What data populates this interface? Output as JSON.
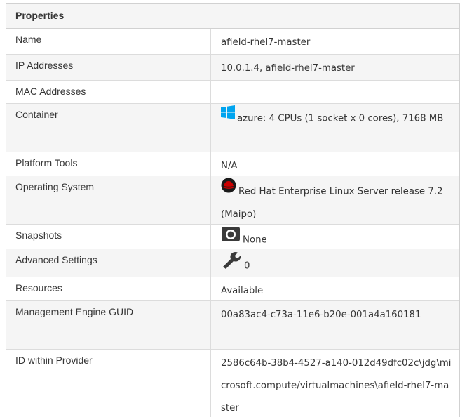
{
  "panel": {
    "title": "Properties",
    "rows": [
      {
        "label": "Name",
        "value": "afield-rhel7-master"
      },
      {
        "label": "IP Addresses",
        "value": "10.0.1.4, afield-rhel7-master"
      },
      {
        "label": "MAC Addresses",
        "value": ""
      },
      {
        "label": "Container",
        "value": "azure: 4 CPUs (1 socket x 0 cores), 7168 MB",
        "icon": "windows-logo-icon"
      },
      {
        "label": "Platform Tools",
        "value": "N/A"
      },
      {
        "label": "Operating System",
        "value": "Red Hat Enterprise Linux Server release 7.2 (Maipo)",
        "icon": "redhat-logo-icon"
      },
      {
        "label": "Snapshots",
        "value": "None",
        "icon": "camera-icon"
      },
      {
        "label": "Advanced Settings",
        "value": "0",
        "icon": "wrench-icon"
      },
      {
        "label": "Resources",
        "value": "Available"
      },
      {
        "label": "Management Engine GUID",
        "value": "00a83ac4-c73a-11e6-b20e-001a4a160181"
      },
      {
        "label": "ID within Provider",
        "value": "2586c64b-38b4-4527-a140-012d49dfc02c\\jdg\\microsoft.compute/virtualmachines\\afield-rhel7-master"
      }
    ]
  }
}
